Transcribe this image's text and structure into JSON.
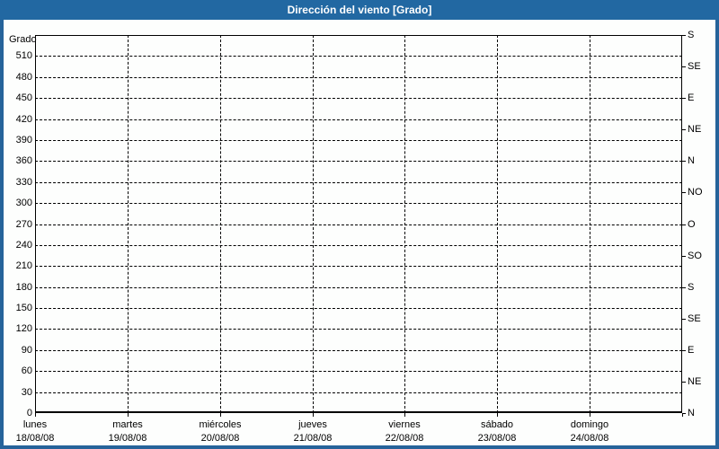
{
  "window": {
    "title": "Dirección del viento [Grado]"
  },
  "colors": {
    "title_bar": "#2268a2",
    "frame_border": "#26639a",
    "background": "#fdfefd",
    "title_text": "#ffffff",
    "plot_border": "#000000",
    "grid": "#000000",
    "text": "#000000"
  },
  "chart_data": {
    "type": "line",
    "title": "Dirección del viento [Grado]",
    "ylabel": "Grado",
    "ylim": [
      0,
      540
    ],
    "y_left_tick_step": 30,
    "y_left_ticks": [
      0,
      30,
      60,
      90,
      120,
      150,
      180,
      210,
      240,
      270,
      300,
      330,
      360,
      390,
      420,
      450,
      480,
      510
    ],
    "y_right_ticks": [
      {
        "value": 0,
        "label": "N"
      },
      {
        "value": 45,
        "label": "NE"
      },
      {
        "value": 90,
        "label": "E"
      },
      {
        "value": 135,
        "label": "SE"
      },
      {
        "value": 180,
        "label": "S"
      },
      {
        "value": 225,
        "label": "SO"
      },
      {
        "value": 270,
        "label": "O"
      },
      {
        "value": 315,
        "label": "NO"
      },
      {
        "value": 360,
        "label": "N"
      },
      {
        "value": 405,
        "label": "NE"
      },
      {
        "value": 450,
        "label": "E"
      },
      {
        "value": 495,
        "label": "SE"
      },
      {
        "value": 540,
        "label": "S"
      }
    ],
    "x_categories": [
      {
        "day": "lunes",
        "date": "18/08/08"
      },
      {
        "day": "martes",
        "date": "19/08/08"
      },
      {
        "day": "miércoles",
        "date": "20/08/08"
      },
      {
        "day": "jueves",
        "date": "21/08/08"
      },
      {
        "day": "viernes",
        "date": "22/08/08"
      },
      {
        "day": "sábado",
        "date": "23/08/08"
      },
      {
        "day": "domingo",
        "date": "24/08/08"
      }
    ],
    "x_day_count": 7,
    "grid": "dashed",
    "legend": "none",
    "series": []
  }
}
